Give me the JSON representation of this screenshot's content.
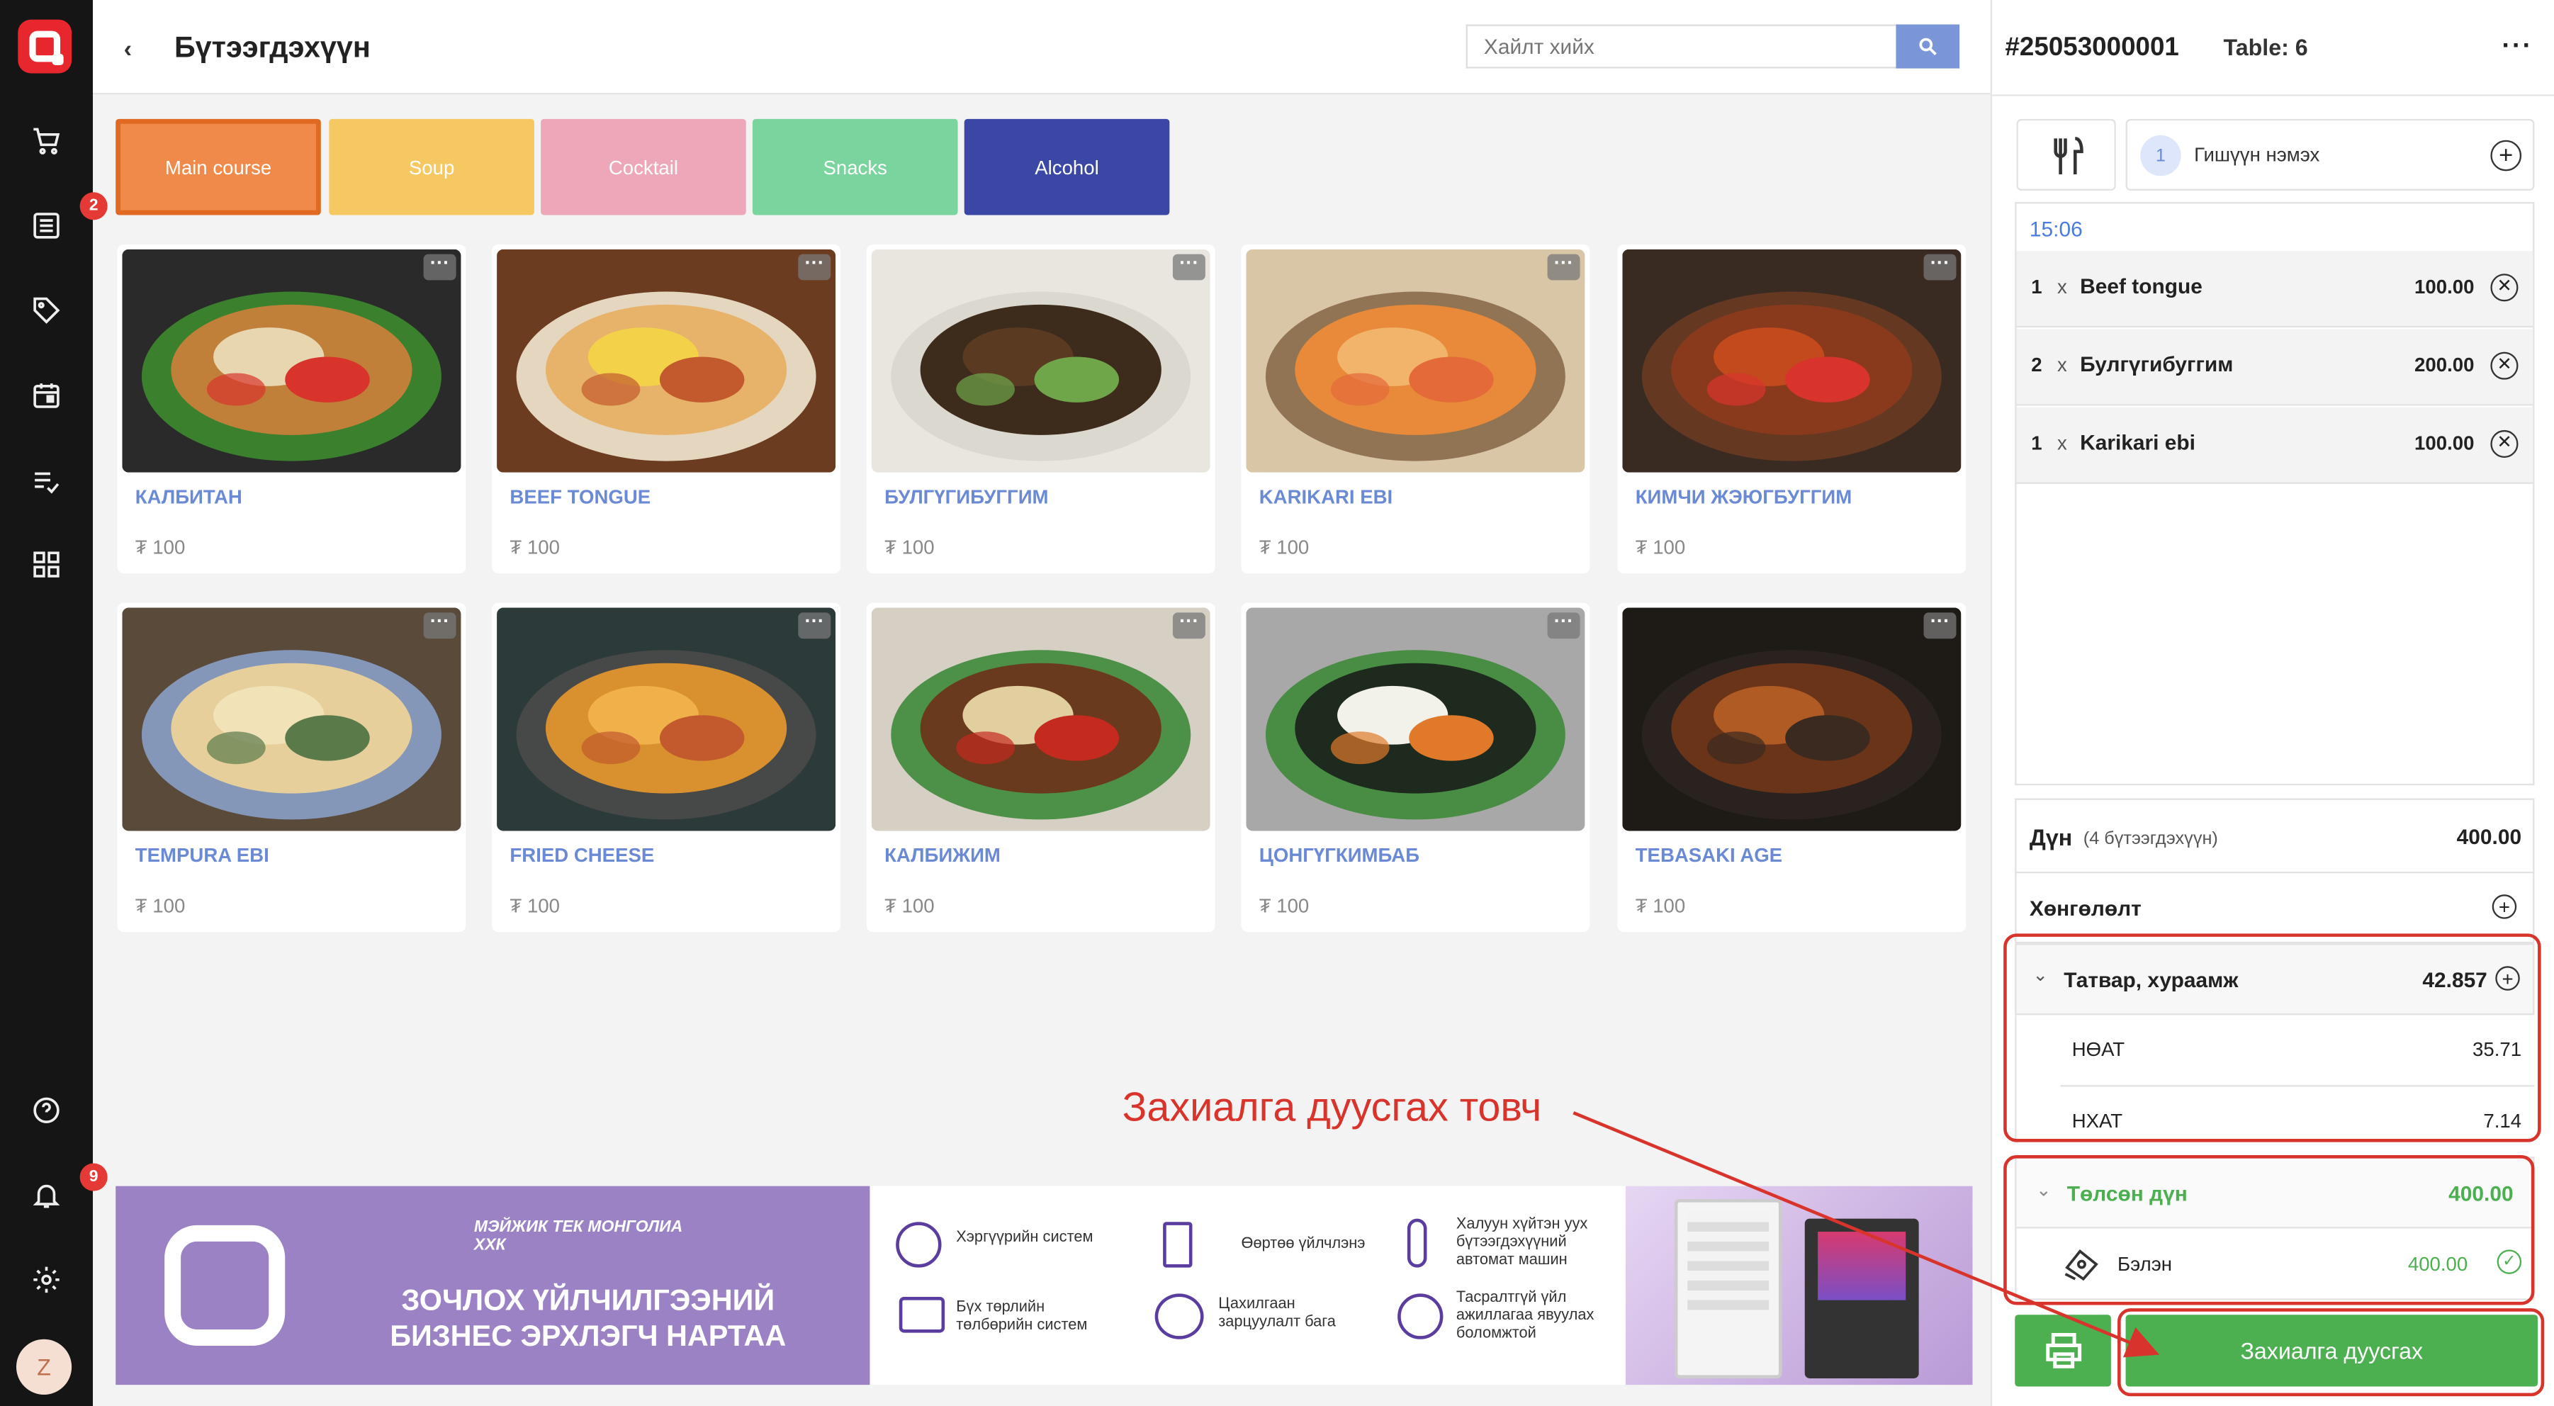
{
  "nav": {
    "badge_orders": "2",
    "badge_notifications": "9",
    "avatar_initial": "Z"
  },
  "header": {
    "title": "Бүтээгдэхүүн",
    "search_placeholder": "Хайлт хийх"
  },
  "categories": [
    {
      "label": "Main course",
      "color": "#f08a4b"
    },
    {
      "label": "Soup",
      "color": "#f5c862"
    },
    {
      "label": "Cocktail",
      "color": "#eda7b8"
    },
    {
      "label": "Snacks",
      "color": "#79d49e"
    },
    {
      "label": "Alcohol",
      "color": "#3b47a5"
    }
  ],
  "products": [
    {
      "name": "КАЛБИТАН",
      "price": "₮ 100"
    },
    {
      "name": "BEEF TONGUE",
      "price": "₮ 100"
    },
    {
      "name": "БУЛГҮГИБУГГИМ",
      "price": "₮ 100"
    },
    {
      "name": "KARIKARI EBI",
      "price": "₮ 100"
    },
    {
      "name": "КИМЧИ ЖЭЮГБУГГИМ",
      "price": "₮ 100"
    },
    {
      "name": "TEMPURA EBI",
      "price": "₮ 100"
    },
    {
      "name": "FRIED CHEESE",
      "price": "₮ 100"
    },
    {
      "name": "КАЛБИЖИМ",
      "price": "₮ 100"
    },
    {
      "name": "ЦОНГҮГКИМБАБ",
      "price": "₮ 100"
    },
    {
      "name": "TEBASAKI AGE",
      "price": "₮ 100"
    }
  ],
  "banner": {
    "brand": "МЭЙЖИК ТЕК МОНГОЛИА ХХК",
    "headline_1": "ЗОЧЛОХ ҮЙЛЧИЛГЭЭНИЙ",
    "headline_2": "БИЗНЕС ЭРХЛЭГЧ НАРТАА",
    "features": [
      "Хэргүүрийн систем",
      "Бүх төрлийн төлбөрийн систем",
      "Өөртөө үйлчлэнэ",
      "Цахилгаан зарцуулалт бага",
      "Халуун хүйтэн уух бүтээгдэхүүний автомат машин",
      "Тасралтгүй үйл ажиллагаа явуулах боломжтой"
    ]
  },
  "order": {
    "number": "#25053000001",
    "table": "Table: 6",
    "guest_count": "1",
    "add_member": "Гишүүн нэмэх",
    "time": "15:06",
    "items": [
      {
        "qty": "1",
        "x": "x",
        "name": "Beef tongue",
        "price": "100.00"
      },
      {
        "qty": "2",
        "x": "x",
        "name": "Булгүгибуггим",
        "price": "200.00"
      },
      {
        "qty": "1",
        "x": "x",
        "name": "Karikari ebi",
        "price": "100.00"
      }
    ],
    "subtotal_label": "Дүн",
    "subtotal_note": "(4 бүтээгдэхүүн)",
    "subtotal_value": "400.00",
    "discount_label": "Хөнгөлөлт",
    "tax_label": "Татвар, хураамж",
    "tax_value": "42.857",
    "vat_label": "НӨАТ",
    "vat_value": "35.71",
    "city_tax_label": "НХАТ",
    "city_tax_value": "7.14",
    "paid_label": "Төлсөн дүн",
    "paid_value": "400.00",
    "cash_label": "Бэлэн",
    "cash_value": "400.00",
    "finish_button": "Захиалга дуусгах"
  },
  "annotation": {
    "text": "Захиалга дуусгах товч",
    "color": "#d9342b"
  },
  "colors": {
    "accent": "#6b8ad6",
    "green": "#4caf50",
    "red": "#d9342b"
  }
}
